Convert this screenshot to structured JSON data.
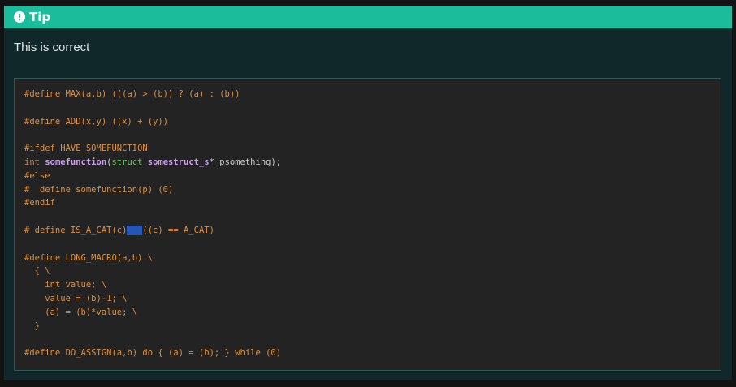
{
  "admonition": {
    "title": "Tip",
    "icon": "exclamation-circle-icon",
    "text": "This is correct"
  },
  "code": {
    "language": "c",
    "lines": [
      "#define MAX(a,b) (((a) > (b)) ? (a) : (b))",
      "",
      "#define ADD(x,y) ((x) + (y))",
      "",
      "#ifdef HAVE_SOMEFUNCTION",
      "int somefunction(struct somestruct_s* psomething);",
      "#else",
      "#  define somefunction(p) (0)",
      "#endif",
      "",
      "# define IS_A_CAT(c)   ((c) == A_CAT)",
      "",
      "#define LONG_MACRO(a,b) \\",
      "  { \\",
      "    int value; \\",
      "    value = (b)-1; \\",
      "    (a) = (b)*value; \\",
      "  }",
      "",
      "#define DO_ASSIGN(a,b) do { (a) = (b); } while (0)"
    ]
  },
  "colors": {
    "header": "#1abc9c",
    "panel": "#11282a",
    "code_bg": "#232323",
    "preprocessor": "#e08f38",
    "function": "#ce9cf6",
    "type": "#64c65f",
    "selection": "#2456b8"
  }
}
